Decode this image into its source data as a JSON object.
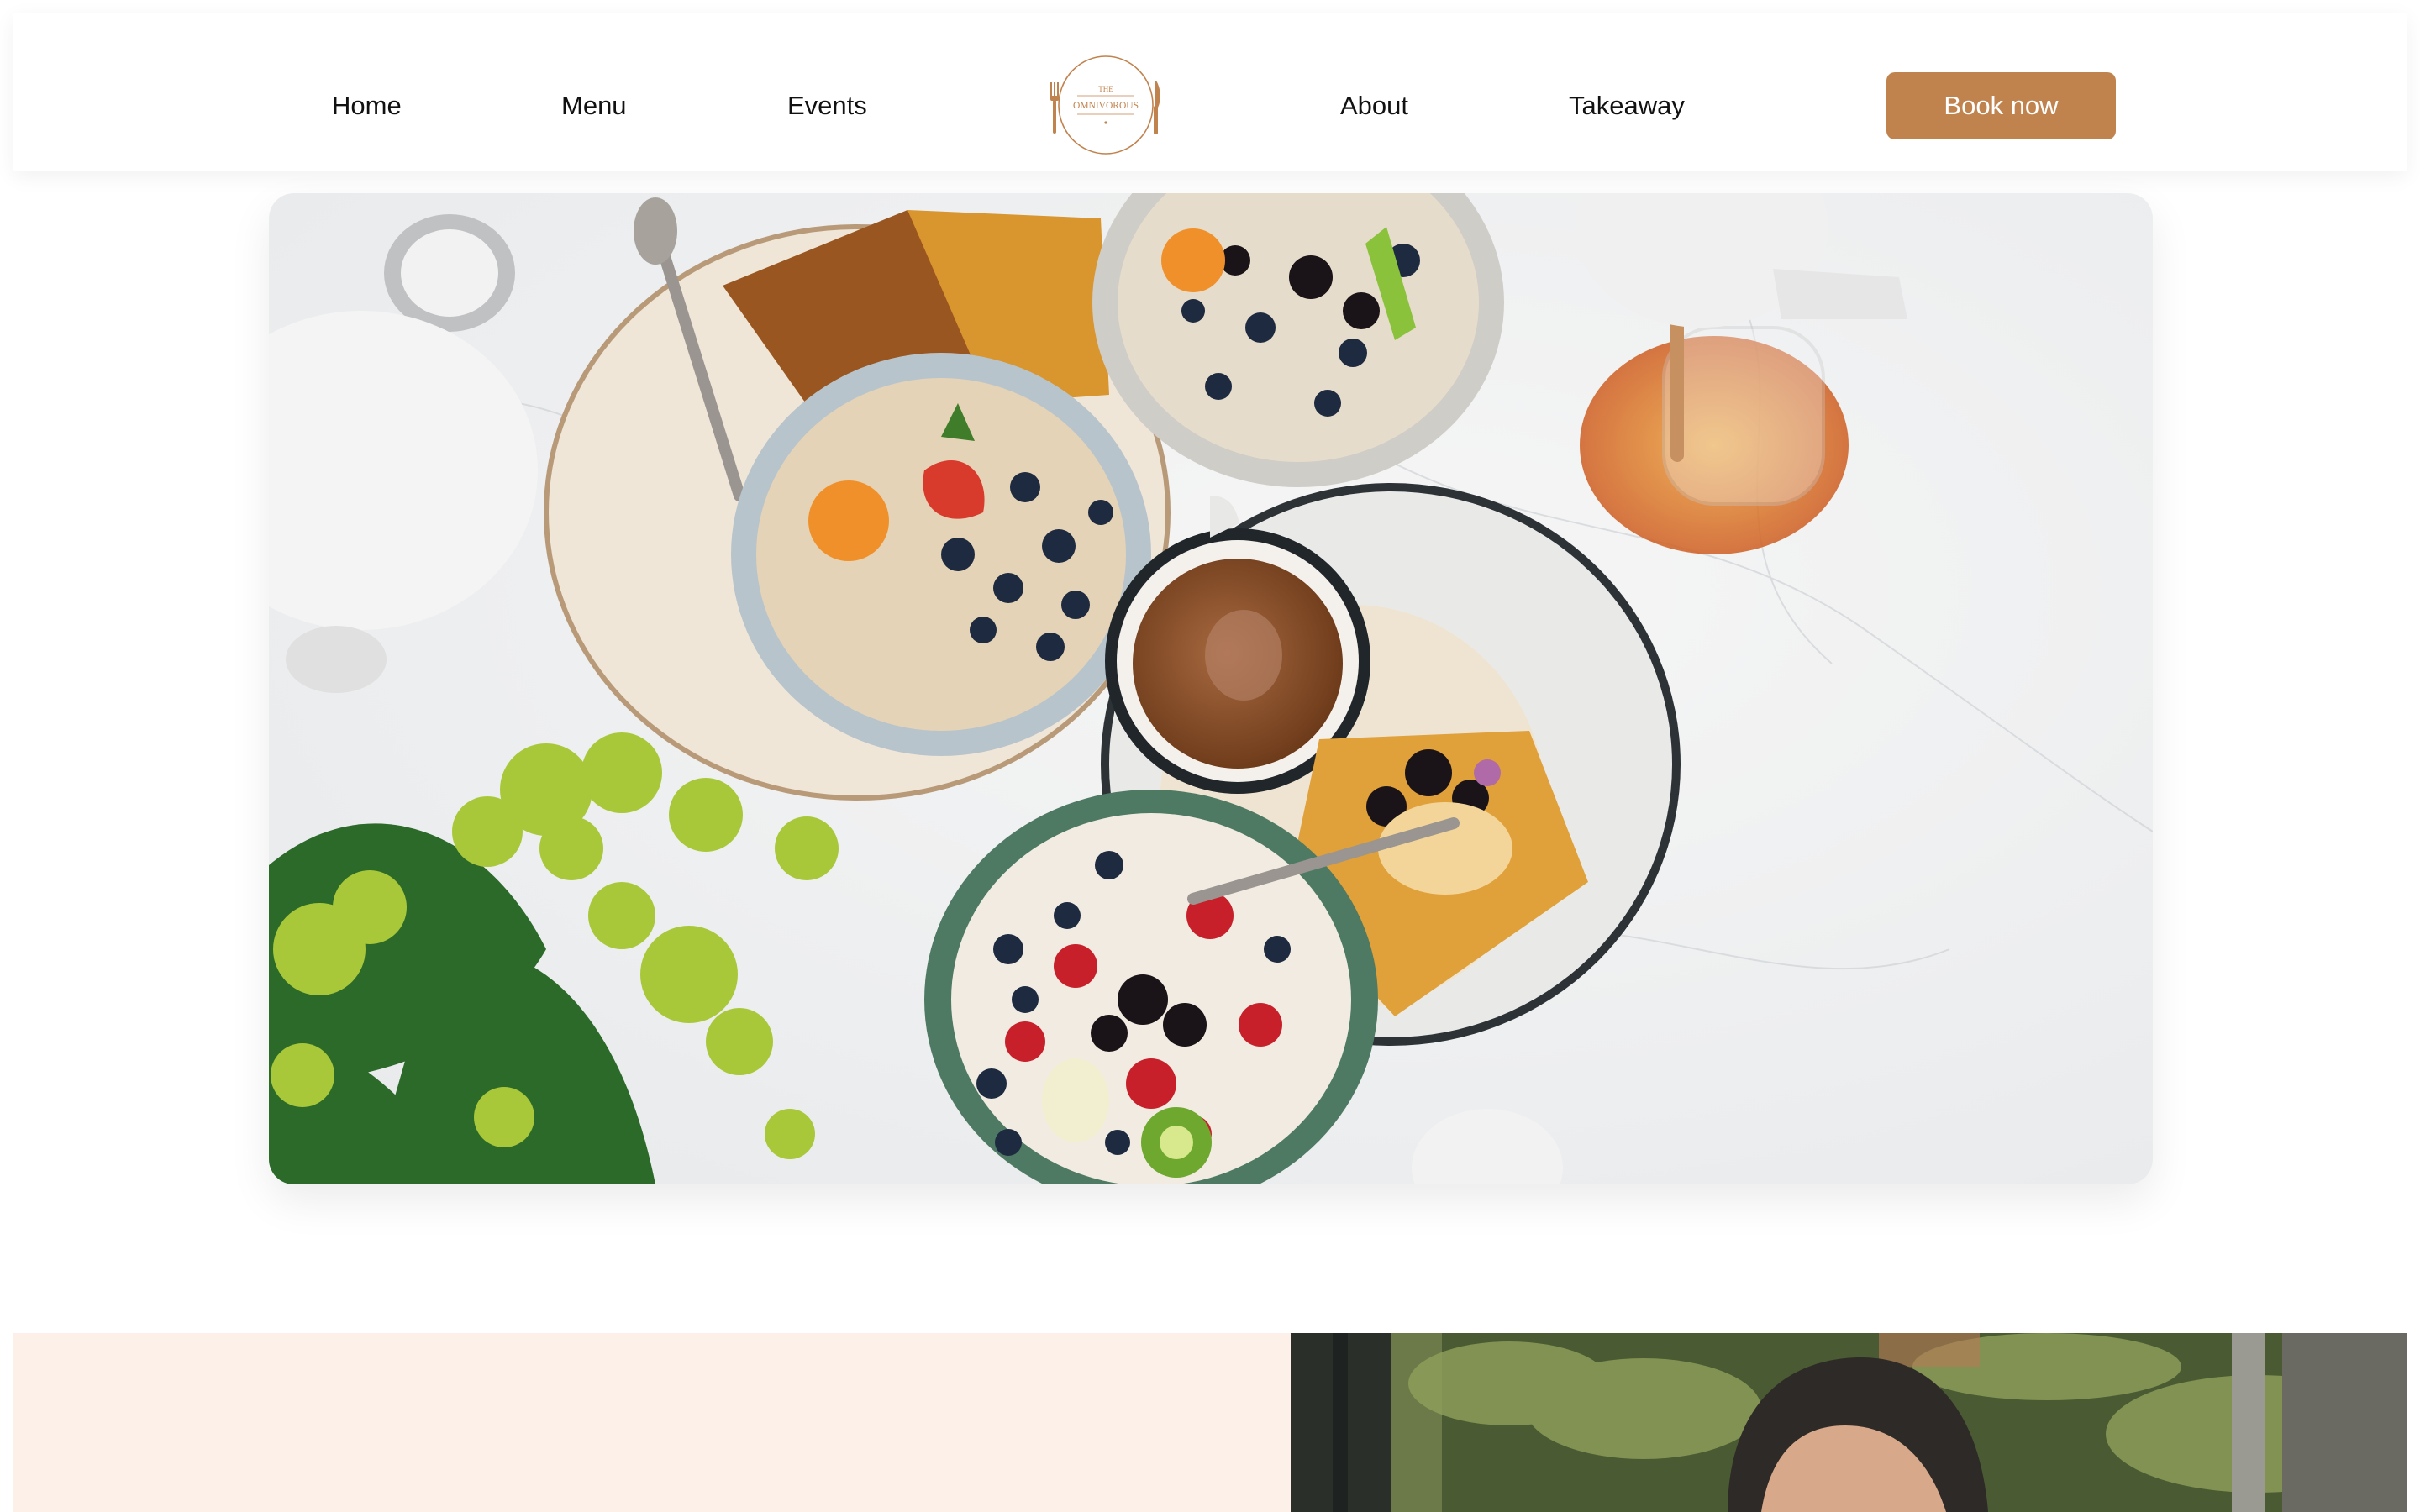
{
  "nav": {
    "home": "Home",
    "menu": "Menu",
    "events": "Events",
    "about": "About",
    "takeaway": "Takeaway",
    "book_label": "Book now"
  },
  "logo": {
    "line1": "THE",
    "line2": "OMNIVOROUS"
  },
  "colors": {
    "accent": "#c0834e",
    "section_bg": "#fcf0e8"
  },
  "hero": {
    "image": "breakfast-table-photo"
  },
  "section": {
    "image": "woman-portrait-photo"
  }
}
